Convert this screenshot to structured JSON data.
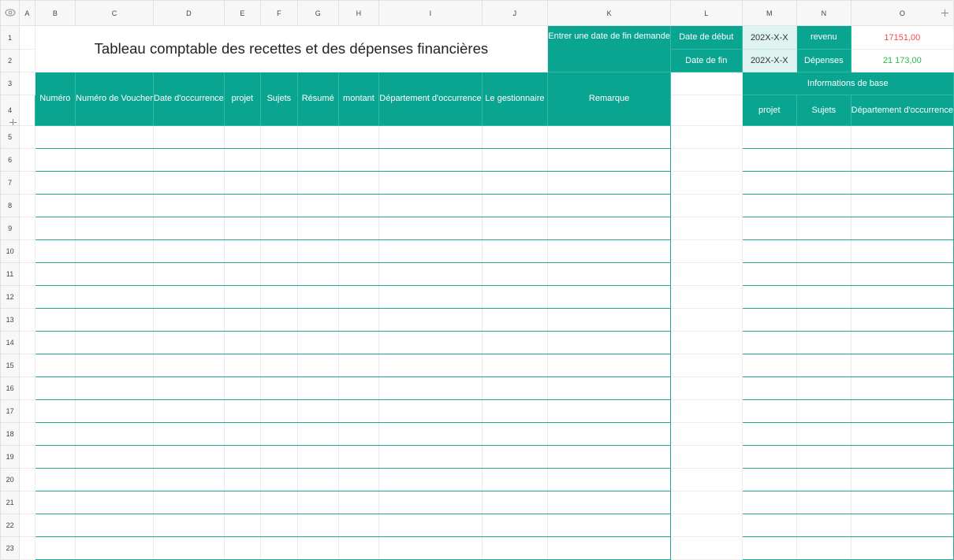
{
  "columns": [
    "A",
    "B",
    "C",
    "D",
    "E",
    "F",
    "G",
    "H",
    "I",
    "J",
    "K",
    "L",
    "M",
    "N",
    "O"
  ],
  "rows": [
    "1",
    "2",
    "3",
    "4",
    "5",
    "6",
    "7",
    "8",
    "9",
    "10",
    "11",
    "12",
    "13",
    "14",
    "15",
    "16",
    "17",
    "18",
    "19",
    "20",
    "21",
    "22",
    "23"
  ],
  "title": "Tableau comptable des recettes et des dépenses financières",
  "enter_date_label": "Entrer une date de fin demande",
  "start_date_label": "Date de début",
  "end_date_label": "Date de fin",
  "start_date_value": "202X-X-X",
  "end_date_value": "202X-X-X",
  "revenue_label": "revenu",
  "revenue_value": "17151,00",
  "expenses_label": "Dépenses",
  "expenses_value": "21 173,00",
  "table_headers": [
    "Numéro",
    "Numéro de Voucher",
    "Date d'occurrence",
    "projet",
    "Sujets",
    "Résumé",
    "montant",
    "Département d'occurrence",
    "Le gestionnaire",
    "Remarque"
  ],
  "basic_info_title": "Informations de base",
  "basic_info_headers": [
    "projet",
    "Sujets",
    "Département d'occurrence"
  ],
  "colors": {
    "header_teal": "#0aa591",
    "date_cell": "#dff3f0",
    "revenue": "#ef4b4b",
    "expenses": "#2bbb48"
  },
  "icons": {
    "visibility": "eye-icon",
    "column_freeze": "grip-icon",
    "row_freeze": "grip-icon"
  }
}
